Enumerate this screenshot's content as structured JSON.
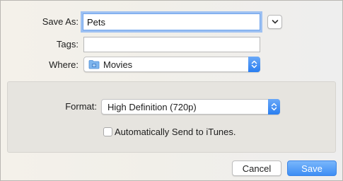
{
  "save_as": {
    "label": "Save As:",
    "value": "Pets"
  },
  "tags": {
    "label": "Tags:",
    "value": ""
  },
  "where": {
    "label": "Where:",
    "value": "Movies",
    "icon": "folder-icon"
  },
  "format": {
    "label": "Format:",
    "value": "High Definition (720p)"
  },
  "itunes": {
    "label": "Automatically Send to iTunes.",
    "checked": false
  },
  "buttons": {
    "cancel": "Cancel",
    "save": "Save"
  },
  "colors": {
    "accent": "#2a7ef0",
    "focus_ring": "#9ec1f2"
  }
}
